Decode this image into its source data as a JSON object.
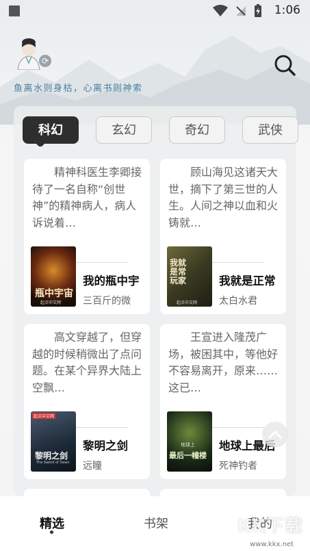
{
  "status_bar": {
    "time": "1:06"
  },
  "header": {
    "slogan": "鱼离水则身枯，心离书则神索"
  },
  "tabs": [
    {
      "label": "科幻",
      "active": true
    },
    {
      "label": "玄幻",
      "active": false
    },
    {
      "label": "奇幻",
      "active": false
    },
    {
      "label": "武侠",
      "active": false
    }
  ],
  "books": [
    {
      "desc": "精神科医生李卿接待了一名自称“创世神”的精神病人，病人诉说着…",
      "title": "我的瓶中宇",
      "author": "三百斤的微",
      "cover_text": "瓶中宇宙",
      "cover_sub": "起点中文网",
      "cover_color": "#2a1a10"
    },
    {
      "desc": "顾山海见这诸天大世，摘下了第三世的人生。人间之神以血和火铸就…",
      "title": "我就是正常",
      "author": "太白水君",
      "cover_text": "我就是常玩家",
      "cover_sub": "起点中文网",
      "cover_color": "#3d3a26"
    },
    {
      "desc": "高文穿越了，但穿越的时候稍微出了点问题。在某个异界大陆上空飘…",
      "title": "黎明之剑",
      "author": "远瞳",
      "cover_text": "黎明之剑",
      "cover_sub": "The Sword of Dawn",
      "cover_badge": "起点中文网",
      "cover_color": "#1f2c3a"
    },
    {
      "desc": "王宣进入隆茂广场，被困其中，等他好不容易离开，原来……这已…",
      "title": "地球上最后",
      "author": "死神钓者",
      "cover_text": "最后一幢楼",
      "cover_sub": "地球上",
      "cover_color": "#1b2a18"
    }
  ],
  "nav": [
    {
      "label": "精选",
      "active": true
    },
    {
      "label": "书架",
      "active": false
    },
    {
      "label": "我的",
      "active": false
    }
  ],
  "watermark": {
    "main": "KK下载",
    "url": "www.kkx.net"
  },
  "colors": {
    "accent": "#2e2e2e",
    "slogan": "#4a7fa0",
    "card_bg": "#ffffff"
  },
  "icons": {
    "search": "search-icon",
    "avatar": "avatar-icon",
    "sync": "sync-icon",
    "scroll_top": "chevron-up-icon"
  }
}
